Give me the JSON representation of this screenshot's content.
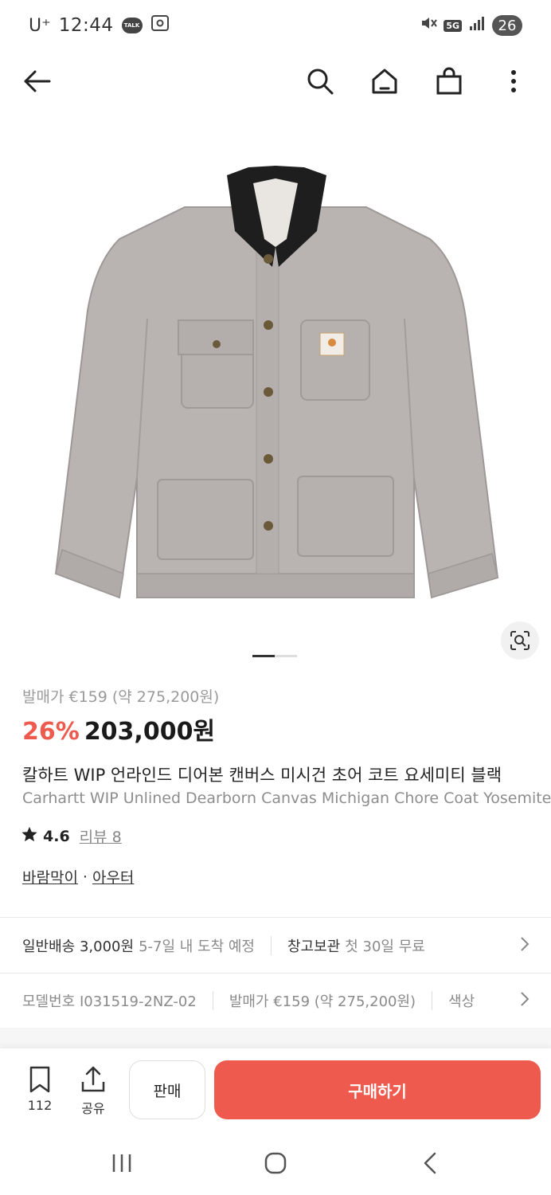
{
  "status_bar": {
    "carrier": "U⁺",
    "time": "12:44",
    "talk_label": "TALK",
    "network": "5G",
    "battery": "26"
  },
  "nav": {
    "icons": [
      "back-arrow-icon",
      "search-icon",
      "home-icon",
      "shopping-bag-icon",
      "more-vertical-icon"
    ]
  },
  "product": {
    "original_price": "발매가 €159 (약 275,200원)",
    "discount": "26%",
    "sale_price": "203,000원",
    "title_ko": "칼하트 WIP 언라인드 디어본 캔버스 미시건 초어 코트 요세미티 블랙",
    "title_en": "Carhartt WIP Unlined Dearborn Canvas Michigan Chore Coat Yosemite",
    "rating": "4.6",
    "review_label": "리뷰 8",
    "category_1": "바람막이",
    "category_sep": "·",
    "category_2": "아우터",
    "image_count": 2,
    "image_index": 1
  },
  "shipping": {
    "label": "일반배송 3,000원",
    "eta": "5-7일 내 도착 예정",
    "storage_label": "창고보관",
    "storage_detail": "첫 30일 무료"
  },
  "details": {
    "model": "모델번호 I031519-2NZ-02",
    "release": "발매가 €159 (약 275,200원)",
    "color": "색상"
  },
  "bottom_bar": {
    "bookmark_count": "112",
    "share_label": "공유",
    "sell_label": "판매",
    "buy_label": "구매하기"
  },
  "colors": {
    "accent": "#ef5a4e",
    "jacket": "#b7b2b0",
    "collar": "#1e1e1e"
  }
}
